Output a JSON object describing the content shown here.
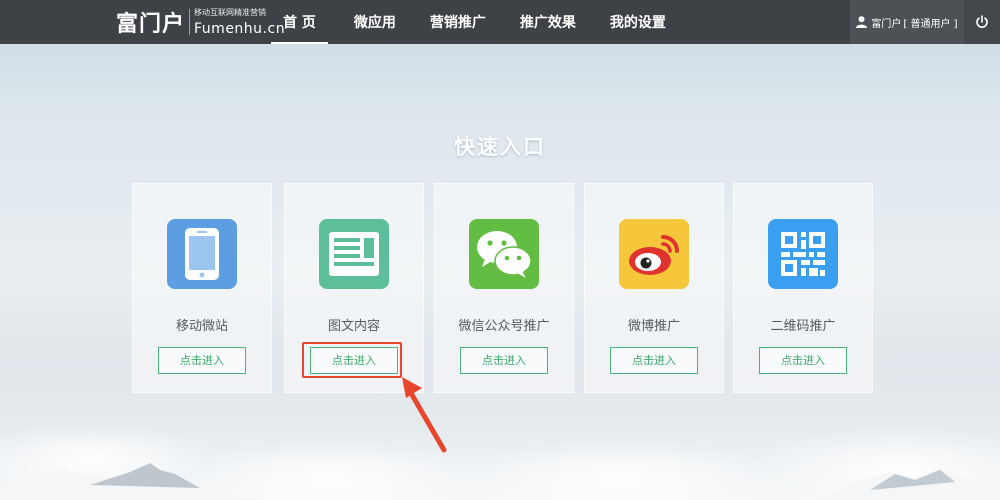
{
  "header": {
    "logo_cn": "富门户",
    "logo_slogan": "移动互联网精准营销",
    "logo_en": "Fumenhu.cn",
    "nav": [
      {
        "label": "首 页",
        "active": true
      },
      {
        "label": "微应用",
        "active": false
      },
      {
        "label": "营销推广",
        "active": false
      },
      {
        "label": "推广效果",
        "active": false
      },
      {
        "label": "我的设置",
        "active": false
      }
    ],
    "user_name": "富门户",
    "user_role": "[ 普通用户 ]"
  },
  "main": {
    "section_title": "快速入口",
    "cards": [
      {
        "label": "移动微站",
        "button": "点击进入",
        "icon": "mobile-phone-icon",
        "color": "#5d9ee3"
      },
      {
        "label": "图文内容",
        "button": "点击进入",
        "icon": "article-icon",
        "color": "#5cbf9a"
      },
      {
        "label": "微信公众号推广",
        "button": "点击进入",
        "icon": "wechat-icon",
        "color": "#64bd43"
      },
      {
        "label": "微博推广",
        "button": "点击进入",
        "icon": "weibo-icon",
        "color": "#f6c73b"
      },
      {
        "label": "二维码推广",
        "button": "点击进入",
        "icon": "qrcode-icon",
        "color": "#3a9ff1"
      }
    ]
  },
  "colors": {
    "topbar": "#3e4247",
    "button_green": "#3aa76a",
    "annotation_red": "#e8452c"
  }
}
